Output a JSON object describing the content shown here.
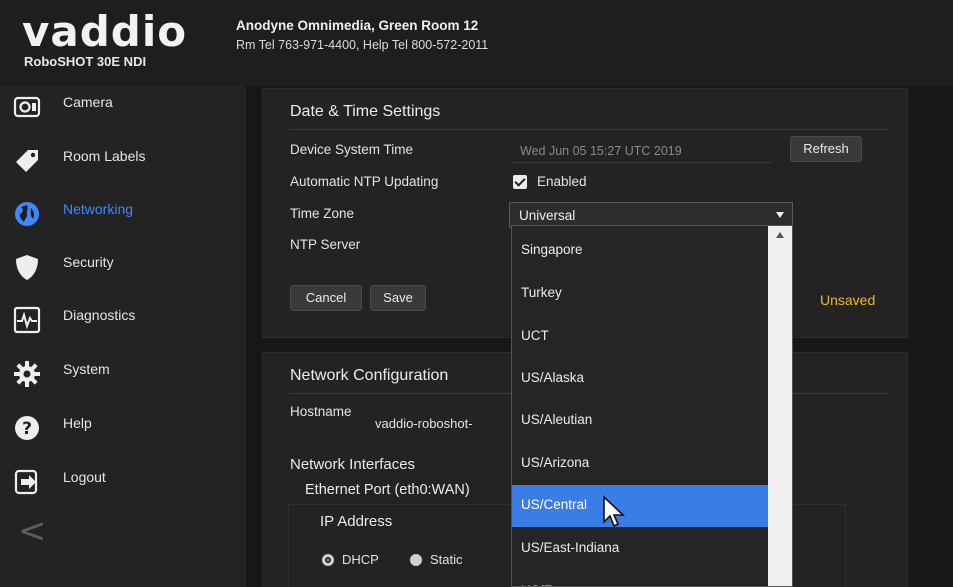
{
  "header": {
    "logo_text": "vaddio",
    "model": "RoboSHOT 30E NDI",
    "room_title": "Anodyne Omnimedia, Green Room 12",
    "room_phone": "Rm Tel 763-971-4400, Help Tel 800-572-2011"
  },
  "sidebar": {
    "items": [
      {
        "label": "Camera",
        "icon": "camera-icon"
      },
      {
        "label": "Room Labels",
        "icon": "tag-icon"
      },
      {
        "label": "Networking",
        "icon": "globe-icon",
        "active": true
      },
      {
        "label": "Security",
        "icon": "shield-icon"
      },
      {
        "label": "Diagnostics",
        "icon": "pulse-icon"
      },
      {
        "label": "System",
        "icon": "gear-icon"
      },
      {
        "label": "Help",
        "icon": "help-icon"
      },
      {
        "label": "Logout",
        "icon": "logout-icon"
      }
    ],
    "collapse_glyph": "<"
  },
  "datetime": {
    "title": "Date & Time Settings",
    "device_time_label": "Device System Time",
    "device_time_value": "Wed Jun 05 15:27 UTC 2019",
    "refresh_label": "Refresh",
    "ntp_label": "Automatic NTP Updating",
    "ntp_enabled_label": "Enabled",
    "timezone_label": "Time Zone",
    "timezone_value": "Universal",
    "ntp_server_label": "NTP Server",
    "cancel_label": "Cancel",
    "save_label": "Save",
    "unsaved_label": "Unsaved"
  },
  "network": {
    "title": "Network Configuration",
    "hostname_label": "Hostname",
    "hostname_value": "vaddio-roboshot-",
    "interfaces_title": "Network Interfaces",
    "port_title": "Ethernet Port (eth0:WAN)",
    "ip_title": "IP Address",
    "dhcp_label": "DHCP",
    "static_label": "Static"
  },
  "timezone_options": [
    "Singapore",
    "Turkey",
    "UCT",
    "US/Alaska",
    "US/Aleutian",
    "US/Arizona",
    "US/Central",
    "US/East-Indiana",
    "US/Eastern"
  ],
  "highlighted_option": "US/Central",
  "colors": {
    "accent": "#3f86ff",
    "highlight": "#3a7de6",
    "unsaved": "#f2b51c"
  }
}
